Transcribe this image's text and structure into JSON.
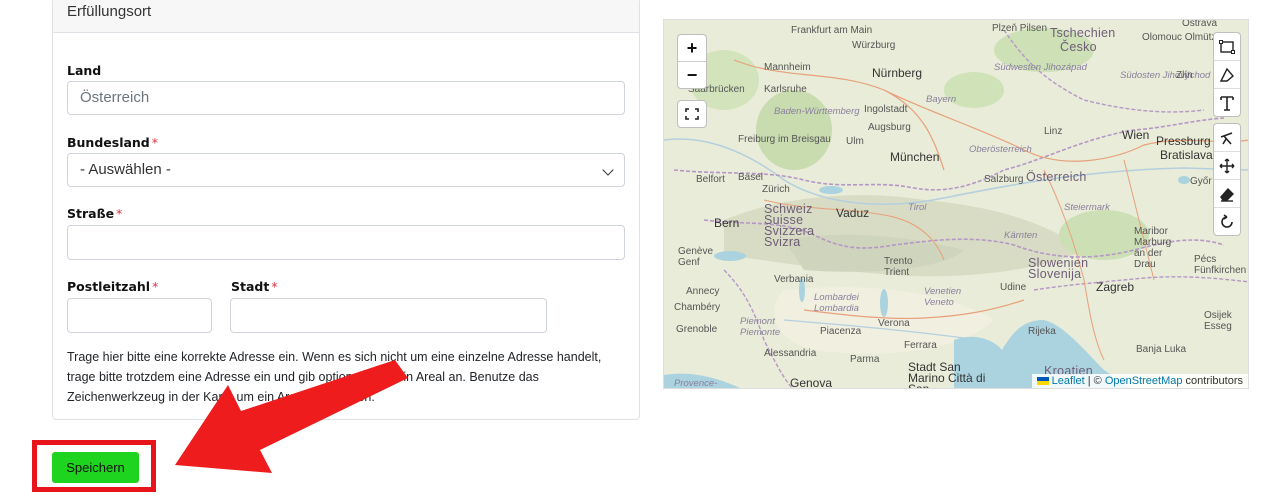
{
  "card": {
    "title": "Erfüllungsort",
    "land_label": "Land",
    "land_placeholder": "Österreich",
    "bundesland_label": "Bundesland",
    "bundesland_value": "- Auswählen -",
    "strasse_label": "Straße",
    "plz_label": "Postleitzahl",
    "stadt_label": "Stadt",
    "required_marker": "*",
    "help_text": "Trage hier bitte eine korrekte Adresse ein. Wenn es sich nicht um eine einzelne Adresse handelt, trage bitte trotzdem eine Adresse ein und gib optional noch ein Areal an. Benutze das Zeichenwerkzeug in der Karte um ein Areal anzugeben."
  },
  "map": {
    "zoom_in": "+",
    "zoom_out": "−",
    "attribution_leaflet": "Leaflet",
    "attribution_sep": " | © ",
    "attribution_osm": "OpenStreetMap",
    "attribution_suffix": " contributors",
    "labels": {
      "frankfurt": "Frankfurt am Main",
      "wuerzburg": "Würzburg",
      "plzen": "Plzeň Pilsen",
      "tschechien": "Tschechien",
      "cesko": "Česko",
      "olomouc": "Olomouc Olmütz",
      "ostrava": "Ostrava",
      "mannheim": "Mannheim",
      "nuernberg": "Nürnberg",
      "suedwesten": "Südwesten Jihozápad",
      "suedosten": "Südosten Jihovýchod",
      "zlin": "Zlín",
      "saarbruecken": "Saarbrücken",
      "karlsruhe": "Karlsruhe",
      "bayern": "Bayern",
      "bw": "Baden-Württemberg",
      "ingolstadt": "Ingolstadt",
      "augsburg": "Augsburg",
      "linz": "Linz",
      "wien": "Wien",
      "pressburg": "Pressburg",
      "bratislava": "Bratislava",
      "freiburg": "Freiburg im Breisgau",
      "ulm": "Ulm",
      "muenchen": "München",
      "ooe": "Oberösterreich",
      "belfort": "Belfort",
      "basel": "Basel",
      "zuerich": "Zürich",
      "salzburg": "Salzburg",
      "oesterreich": "Österreich",
      "gyor": "Győr Raab",
      "schweiz": "Schweiz Suisse Svizzera Svizra",
      "vaduz": "Vaduz",
      "bern": "Bern",
      "tirol": "Tirol",
      "steiermark": "Steiermark",
      "kaernten": "Kärnten",
      "maribor": "Maribor Marburg an der Drau",
      "geneve": "Genève Genf",
      "trento": "Trento Trient",
      "slowenien": "Slowenien Slovenija",
      "pecs": "Pécs Fünfkirchen",
      "verbania": "Verbania",
      "annecy": "Annecy",
      "chambery": "Chambéry",
      "udine": "Udine",
      "zagreb": "Zagreb",
      "lombardei": "Lombardei Lombardia",
      "venetien": "Venetien Veneto",
      "grenoble": "Grenoble",
      "piemont": "Piemont Piemonte",
      "piacenza": "Piacenza",
      "verona": "Verona",
      "rijeka": "Rijeka",
      "osijek": "Osijek Esseg",
      "ferrara": "Ferrara",
      "alessandria": "Alessandria",
      "parma": "Parma",
      "banja": "Banja Luka",
      "sanmarino": "Stadt San Marino Città di San",
      "kroatien": "Kroatien",
      "genova": "Genova",
      "provence": "Provence-"
    }
  },
  "save_button": "Speichern",
  "colors": {
    "save_green": "#1ed41e",
    "annotation_red": "#e8141c",
    "required_red": "#dc3545"
  }
}
